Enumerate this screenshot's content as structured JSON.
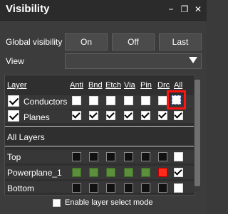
{
  "window": {
    "title": "Visibility",
    "minimize_glyph": "−",
    "restore_glyph": "❐",
    "close_glyph": "✕"
  },
  "global_visibility": {
    "label": "Global visibility",
    "buttons": [
      "On",
      "Off",
      "Last"
    ]
  },
  "view": {
    "label": "View",
    "value": ""
  },
  "columns": {
    "layer": "Layer",
    "headers": [
      "Anti",
      "Bnd",
      "Etch",
      "Via",
      "Pin",
      "Drc",
      "All"
    ]
  },
  "rows": {
    "conductors": {
      "label": "Conductors",
      "checked": true
    },
    "planes": {
      "label": "Planes",
      "checked": true
    },
    "all_layers": {
      "label": "All Layers"
    },
    "top": {
      "label": "Top"
    },
    "powerplane": {
      "label": "Powerplane_1"
    },
    "bottom": {
      "label": "Bottom"
    }
  },
  "footer": {
    "label": "Enable layer select mode",
    "checked": false
  },
  "colors": {
    "highlight": "#ff1414",
    "green": "#5b8f3a",
    "red": "#ff2a1a"
  }
}
